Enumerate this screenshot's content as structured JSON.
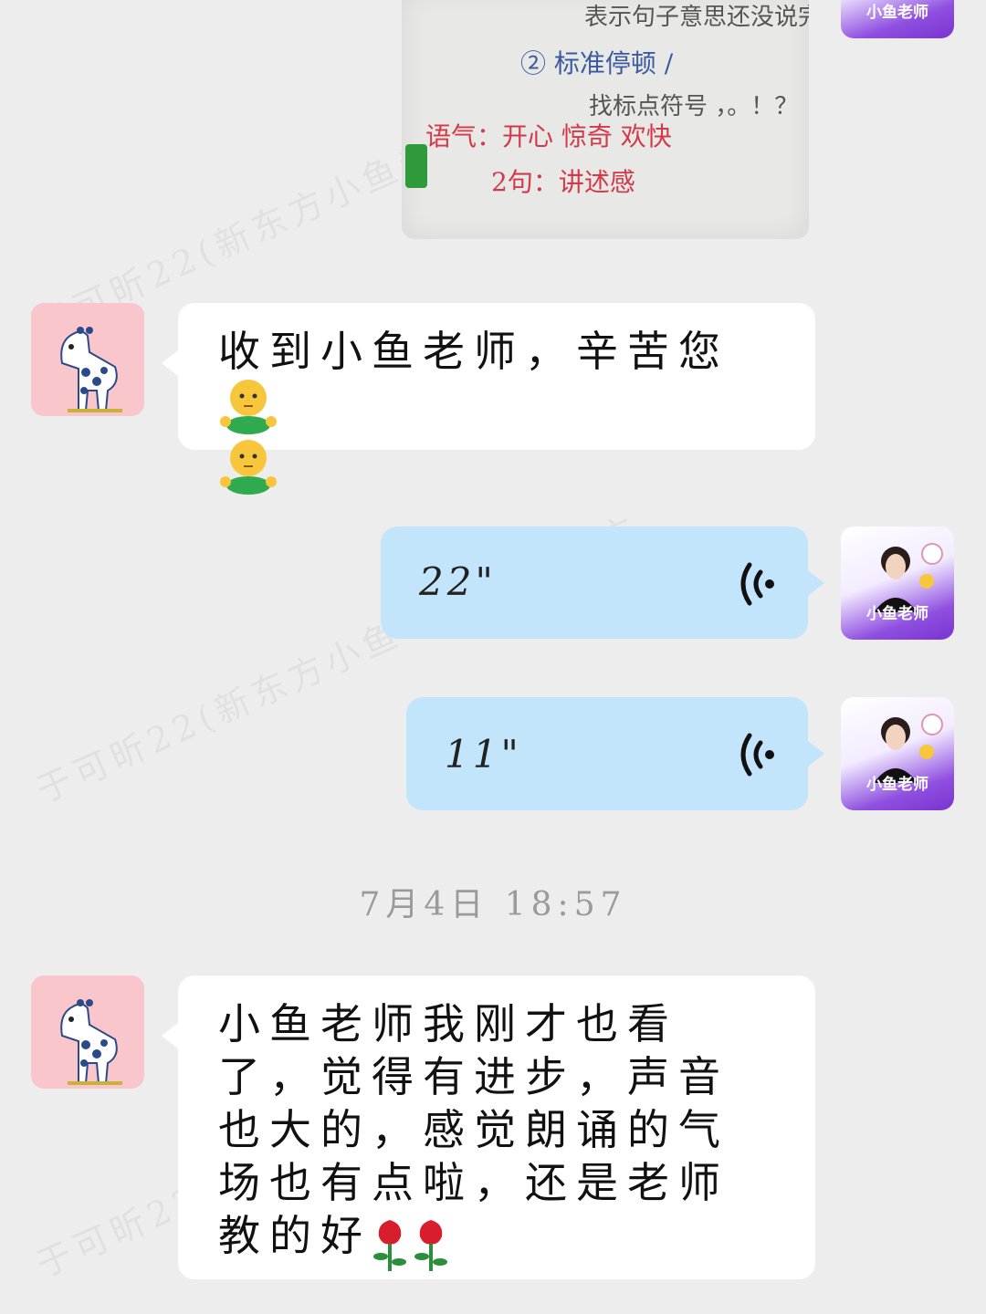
{
  "watermark": "于可昕22(新东方小鱼老师)@新东方",
  "image_message": {
    "lines": [
      "表示句子意思还没说完",
      "② 标准停顿 /",
      "找标点符号 ，。！？",
      "语气：开心 惊奇 欢快",
      "2句：讲述感"
    ]
  },
  "teacher": {
    "avatar_caption": "小鱼老师"
  },
  "messages": [
    {
      "text": "收到小鱼老师，辛苦您"
    },
    {
      "duration": "22\""
    },
    {
      "duration": "11\""
    },
    {
      "text": "小鱼老师我刚才也看了，觉得有进步，声音也大的，感觉朗诵的气场也有点啦，还是老师教的好"
    }
  ],
  "timestamp": "7月4日  18:57",
  "colors": {
    "background": "#ededed",
    "bubble_white": "#ffffff",
    "bubble_blue": "#c3e5fb",
    "friend_avatar_bg": "#f9c6cc"
  }
}
